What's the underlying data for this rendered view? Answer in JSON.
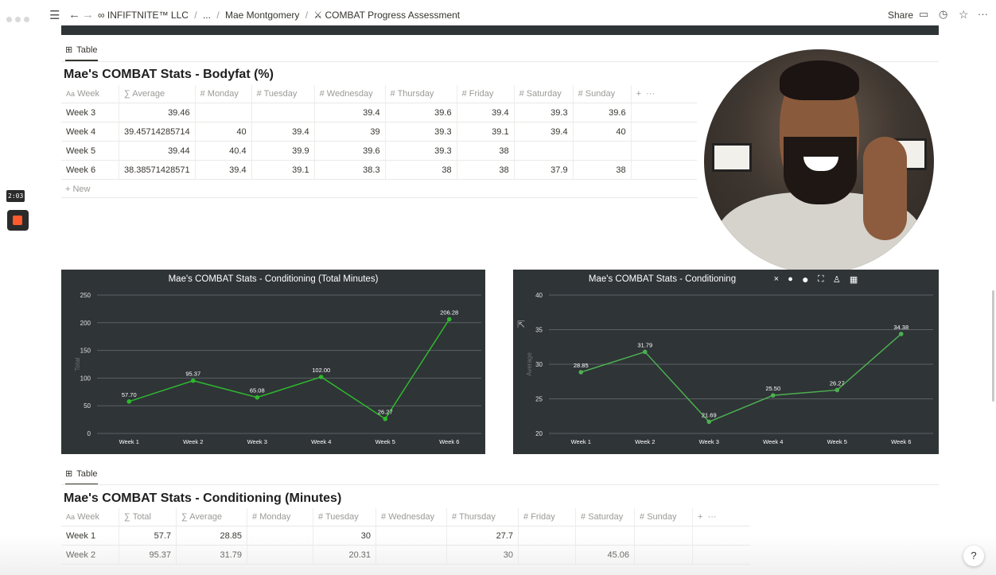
{
  "topbar": {
    "breadcrumbs": [
      "INFIFTNITE™ LLC",
      "...",
      "Mae Montgomery",
      "COMBAT Progress Assessment"
    ],
    "share_label": "Share"
  },
  "recording": {
    "time": "2:03"
  },
  "bodyfat": {
    "tab_label": "Table",
    "title": "Mae's COMBAT Stats - Bodyfat (%)",
    "columns": [
      "Week",
      "Average",
      "Monday",
      "Tuesday",
      "Wednesday",
      "Thursday",
      "Friday",
      "Saturday",
      "Sunday"
    ],
    "rows": [
      [
        "Week 3",
        "39.46",
        "",
        "",
        "39.4",
        "39.6",
        "39.4",
        "39.3",
        "39.6"
      ],
      [
        "Week 4",
        "39.45714285714",
        "40",
        "39.4",
        "39",
        "39.3",
        "39.1",
        "39.4",
        "40"
      ],
      [
        "Week 5",
        "39.44",
        "40.4",
        "39.9",
        "39.6",
        "39.3",
        "38",
        "",
        ""
      ],
      [
        "Week 6",
        "38.38571428571",
        "39.4",
        "39.1",
        "38.3",
        "38",
        "38",
        "37.9",
        "38"
      ]
    ],
    "new_label": "+ New"
  },
  "chart_data": [
    {
      "type": "line",
      "title": "Mae's COMBAT Stats - Conditioning (Total Minutes)",
      "ylabel": "Total",
      "categories": [
        "Week 1",
        "Week 2",
        "Week 3",
        "Week 4",
        "Week 5",
        "Week 6"
      ],
      "values": [
        57.7,
        95.37,
        65.08,
        102.0,
        26.27,
        206.28
      ],
      "value_labels": [
        "57.70",
        "95.37",
        "65.08",
        "102.00",
        "26.27",
        "206.28"
      ],
      "yticks": [
        "0",
        "50",
        "100",
        "150",
        "200",
        "250"
      ],
      "ylim": [
        0,
        250
      ],
      "color": "#2eb82e"
    },
    {
      "type": "line",
      "title": "Mae's COMBAT Stats - Conditioning",
      "ylabel": "Average",
      "categories": [
        "Week 1",
        "Week 2",
        "Week 3",
        "Week 4",
        "Week 5",
        "Week 6"
      ],
      "values": [
        28.85,
        31.79,
        21.69,
        25.5,
        26.27,
        34.38
      ],
      "value_labels": [
        "28.85",
        "31.79",
        "21.69",
        "25.50",
        "26.27",
        "34.38"
      ],
      "yticks": [
        "20",
        "25",
        "30",
        "35",
        "40"
      ],
      "ylim": [
        20,
        40
      ],
      "color": "#4caf50"
    }
  ],
  "conditioning": {
    "tab_label": "Table",
    "title": "Mae's COMBAT Stats - Conditioning (Minutes)",
    "columns": [
      "Week",
      "Total",
      "Average",
      "Monday",
      "Tuesday",
      "Wednesday",
      "Thursday",
      "Friday",
      "Saturday",
      "Sunday"
    ],
    "rows": [
      [
        "Week 1",
        "57.7",
        "28.85",
        "",
        "30",
        "",
        "27.7",
        "",
        "",
        ""
      ],
      [
        "Week 2",
        "95.37",
        "31.79",
        "",
        "20.31",
        "",
        "30",
        "",
        "45.06",
        ""
      ]
    ]
  },
  "colors": {
    "chart_bg": "#2f3437",
    "line": "#2eb82e",
    "record": "#ff5b2e"
  }
}
